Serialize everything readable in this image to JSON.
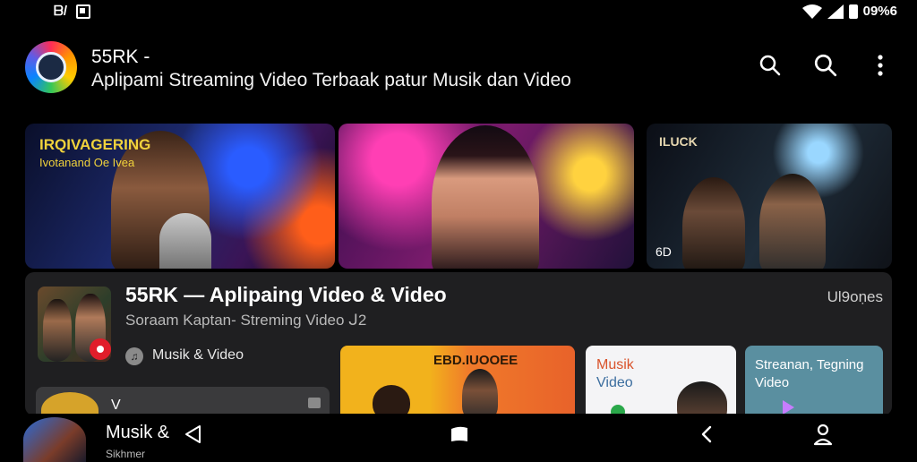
{
  "status_bar": {
    "left_glyph": "ᗷ/",
    "left_icon": "square-icon",
    "battery_text": "09%6",
    "icons": [
      "wifi-icon",
      "signal-icon",
      "battery-icon"
    ]
  },
  "header": {
    "app_name": "55RK -",
    "subtitle": "Aplipami Streaming Video Terbaak patur Musik dan Video",
    "icons": [
      "search-icon",
      "search-icon",
      "more-vert-icon"
    ]
  },
  "hero": {
    "card1_title": "IRQIVAGERING",
    "card1_subtitle": "Ivotanand Oe Ivea",
    "card3_title": "ILUCK",
    "card3_badge": "6D"
  },
  "featured": {
    "title": "55RK — Aplipaing Video & Video",
    "subtitle": "Soraam Kaptan- Streming Video ᒍ2",
    "views": "Ul9oṇes",
    "category": "Musik & Video"
  },
  "tiles": [
    {
      "label": "EBD.IUOOEE"
    },
    {
      "label_line1": "Musik",
      "label_line2": "Video"
    },
    {
      "label_line1": "Streanan, Tegning",
      "label_line2": "Video"
    }
  ],
  "mini_card": {
    "text": "V"
  },
  "bottom_nav": {
    "label": "Musik &",
    "sublabel": "Sikhmer",
    "icons": [
      "back-triangle-icon",
      "home-square-icon",
      "back-chevron-icon",
      "profile-icon"
    ]
  },
  "colors": {
    "background": "#000000",
    "panel": "#1f1f21",
    "accent_red": "#e11d2a",
    "hero_title_yellow": "#f0d23c"
  }
}
